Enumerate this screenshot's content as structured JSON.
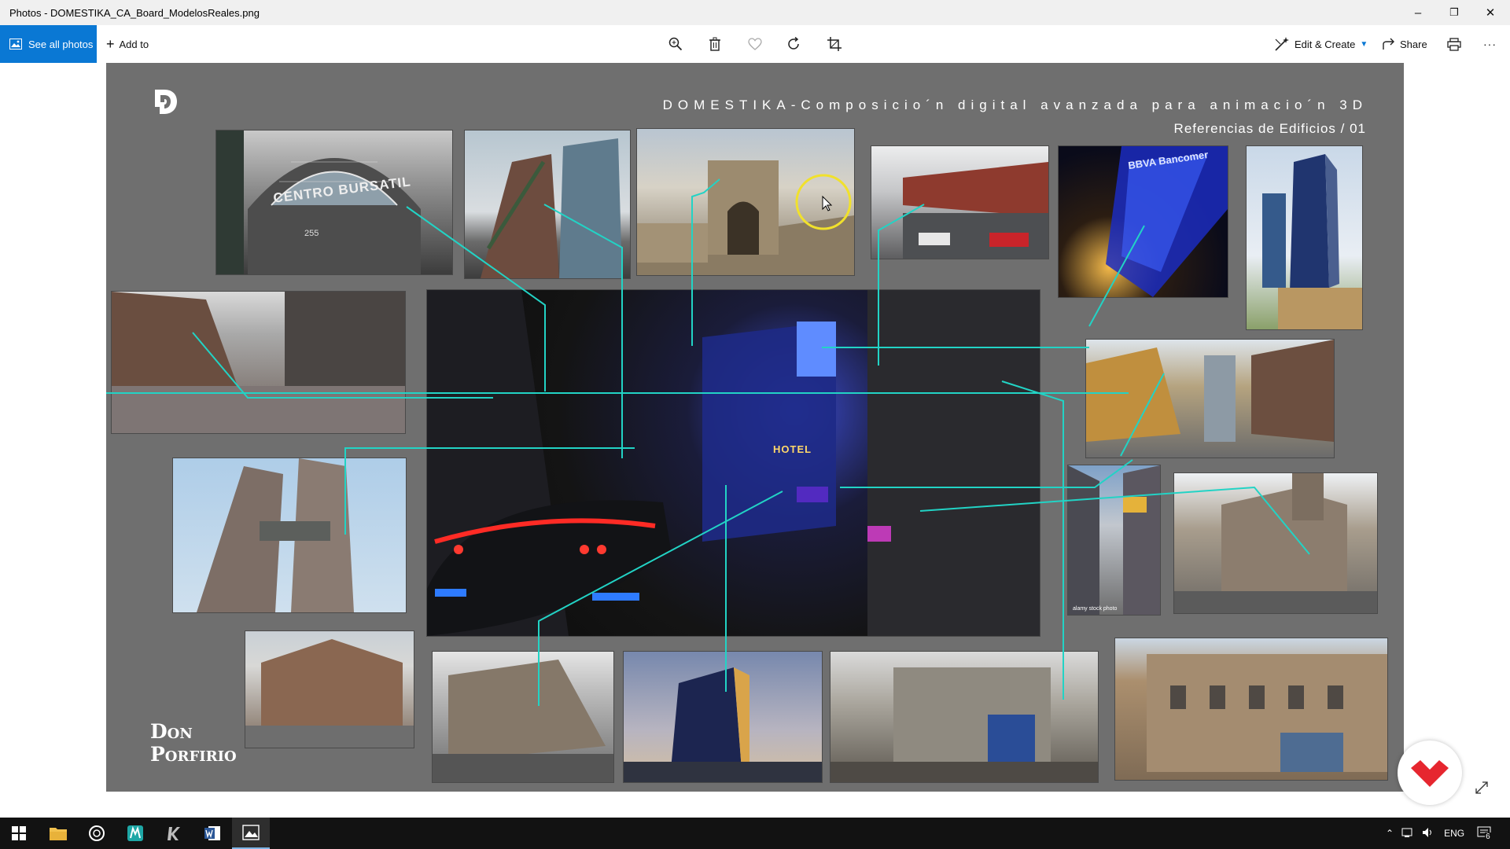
{
  "window": {
    "title": "Photos - DOMESTIKA_CA_Board_ModelosReales.png",
    "minimize_glyph": "–",
    "restore_glyph": "❐",
    "close_glyph": "✕"
  },
  "toolbar": {
    "see_all_label": "See all photos",
    "add_to_label": "Add to",
    "edit_create_label": "Edit & Create",
    "share_label": "Share",
    "more_glyph": "···",
    "icons": [
      "zoom-icon",
      "delete-icon",
      "favorite-icon",
      "rotate-icon",
      "crop-icon",
      "print-icon"
    ]
  },
  "board": {
    "title": "DOMESTIKA-Composicio´n digital avanzada para animacio´n 3D",
    "subtitle": "Referencias de Edificios / 01",
    "signature_line1": "Don",
    "signature_line2": "Porfirio",
    "photo_labels": {
      "bolsa_sign": "CENTRO BURSATIL",
      "bolsa_number": "255",
      "bank_sign": "BBVA Bancomer",
      "hotel_sign": "HOTEL",
      "stock_watermark": "alamy stock photo"
    },
    "accent_line_color": "#22d3c5",
    "background_color": "#6f6f6f"
  },
  "taskbar": {
    "language": "ENG",
    "notification_count": "6",
    "apps": [
      "start-icon",
      "file-explorer-icon",
      "cortana-icon",
      "maya-icon",
      "krita-icon",
      "word-icon",
      "photos-icon"
    ]
  },
  "colors": {
    "accent": "#0a78d4",
    "domestika_red": "#e6262f"
  }
}
